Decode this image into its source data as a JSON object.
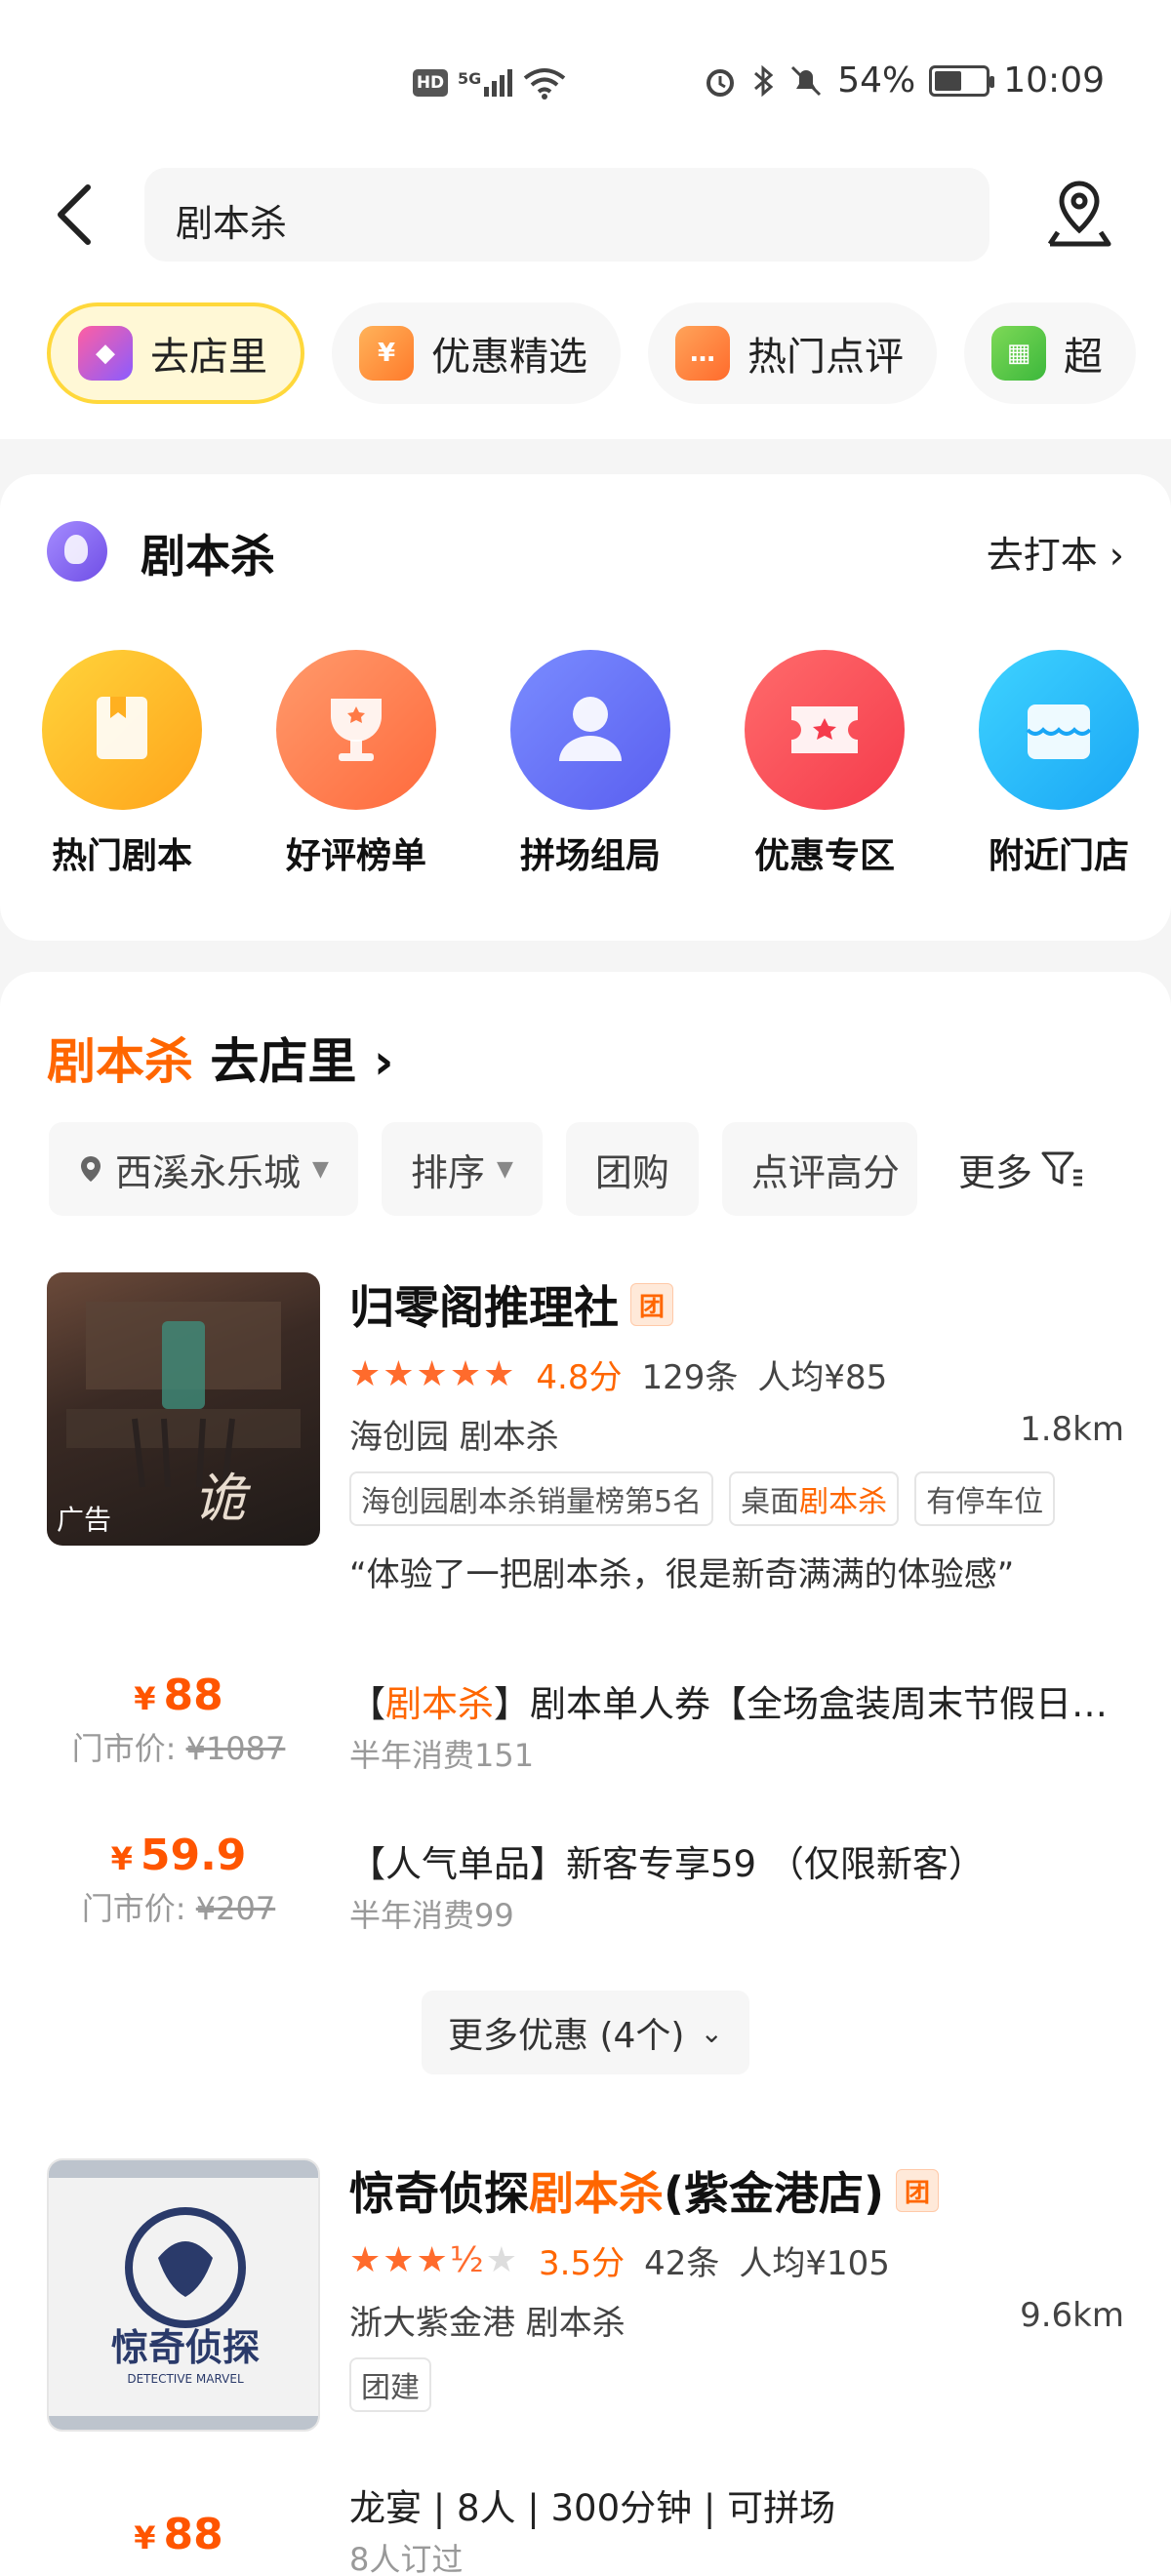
{
  "status_bar": {
    "hd": "HD",
    "signal": "5G",
    "battery": "54%",
    "battery_fraction": 0.54,
    "time": "10:09"
  },
  "header": {
    "search_query": "剧本杀",
    "quick_tabs": [
      {
        "label": "去店里",
        "icon": "store-icon",
        "active": true
      },
      {
        "label": "优惠精选",
        "icon": "coupon-icon",
        "active": false
      },
      {
        "label": "热门点评",
        "icon": "chat-icon",
        "active": false
      },
      {
        "label": "超",
        "icon": "basket-icon",
        "active": false
      }
    ]
  },
  "category": {
    "title": "剧本杀",
    "more_label": "去打本",
    "items": [
      {
        "label": "热门剧本",
        "icon": "book-icon",
        "color_from": "#ffd43b",
        "color_to": "#ffa41b"
      },
      {
        "label": "好评榜单",
        "icon": "trophy-icon",
        "color_from": "#ff9a6b",
        "color_to": "#ff6a3d"
      },
      {
        "label": "拼场组局",
        "icon": "group-icon",
        "color_from": "#7a8cff",
        "color_to": "#5a5ff0"
      },
      {
        "label": "优惠专区",
        "icon": "ticket-icon",
        "color_from": "#ff6b6b",
        "color_to": "#f53b4c"
      },
      {
        "label": "附近门店",
        "icon": "shop-icon",
        "color_from": "#3ed3ff",
        "color_to": "#1aa6f5"
      }
    ]
  },
  "list": {
    "title_highlight": "剧本杀",
    "title_rest": "去店里",
    "filters": [
      "西溪永乐城",
      "排序",
      "团购",
      "点评高分"
    ],
    "filter_more": "更多",
    "shops": [
      {
        "name": "归零阁推理社",
        "tuan": "团",
        "score": "4.8分",
        "reviews": "129条",
        "avg": "人均¥85",
        "area": "海创园  剧本杀",
        "distance": "1.8km",
        "ad": "广告",
        "tags": [
          "海创园剧本杀销量榜第5名",
          "桌面剧本杀",
          "有停车位"
        ],
        "review": "“体验了一把剧本杀，很是新奇满满的体验感”",
        "deals": [
          {
            "price": "88",
            "orig_label": "门市价:",
            "orig": "¥1087",
            "title_pre": "【",
            "title_hl": "剧本杀",
            "title_rest": "】剧本单人券【全场盒装周末节假日通用】",
            "sold": "半年消费151"
          },
          {
            "price": "59.9",
            "orig_label": "门市价:",
            "orig": "¥207",
            "title_pre": "",
            "title_hl": "",
            "title_rest": "【人气单品】新客专享59  （仅限新客）",
            "sold": "半年消费99"
          }
        ],
        "more_deals": "更多优惠 (4个)"
      },
      {
        "name_pre": "惊奇侦探",
        "name_hl": "剧本杀",
        "name_post": "(紫金港店)",
        "tuan": "团",
        "score": "3.5分",
        "reviews": "42条",
        "avg": "人均¥105",
        "area": "浙大紫金港  剧本杀",
        "distance": "9.6km",
        "logo_text": "惊奇侦探",
        "logo_sub": "DETECTIVE MARVEL",
        "tags": [
          "团建"
        ],
        "deal": {
          "price": "88",
          "title": "龙宴 | 8人 | 300分钟 | 可拼场",
          "sold": "8人订过"
        }
      }
    ]
  }
}
